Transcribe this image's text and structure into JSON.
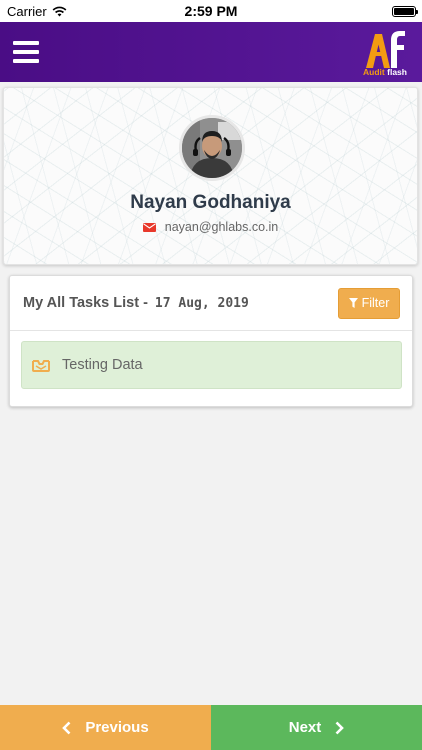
{
  "status_bar": {
    "carrier": "Carrier",
    "time": "2:59 PM",
    "wifi_icon": "wifi-icon",
    "battery_icon": "battery-icon"
  },
  "header": {
    "menu_icon": "hamburger-menu-icon",
    "logo": {
      "mark": "Af",
      "text_part1": "Audit",
      "text_part2": "flash"
    },
    "colors": {
      "background": "#4a0d85",
      "logo_accent": "#f39c12"
    }
  },
  "profile": {
    "name": "Nayan Godhaniya",
    "email": "nayan@ghlabs.co.in",
    "email_icon": "envelope-icon",
    "email_icon_color": "#e8382b"
  },
  "tasks": {
    "title": "My All Tasks List -",
    "date": "17 Aug, 2019",
    "filter_label": "Filter",
    "filter_icon": "funnel-icon",
    "items": [
      {
        "label": "Testing Data",
        "icon": "inbox-tray-icon"
      }
    ]
  },
  "navigation": {
    "previous_label": "Previous",
    "next_label": "Next",
    "previous_color": "#f0ad4e",
    "next_color": "#5cb85c"
  }
}
